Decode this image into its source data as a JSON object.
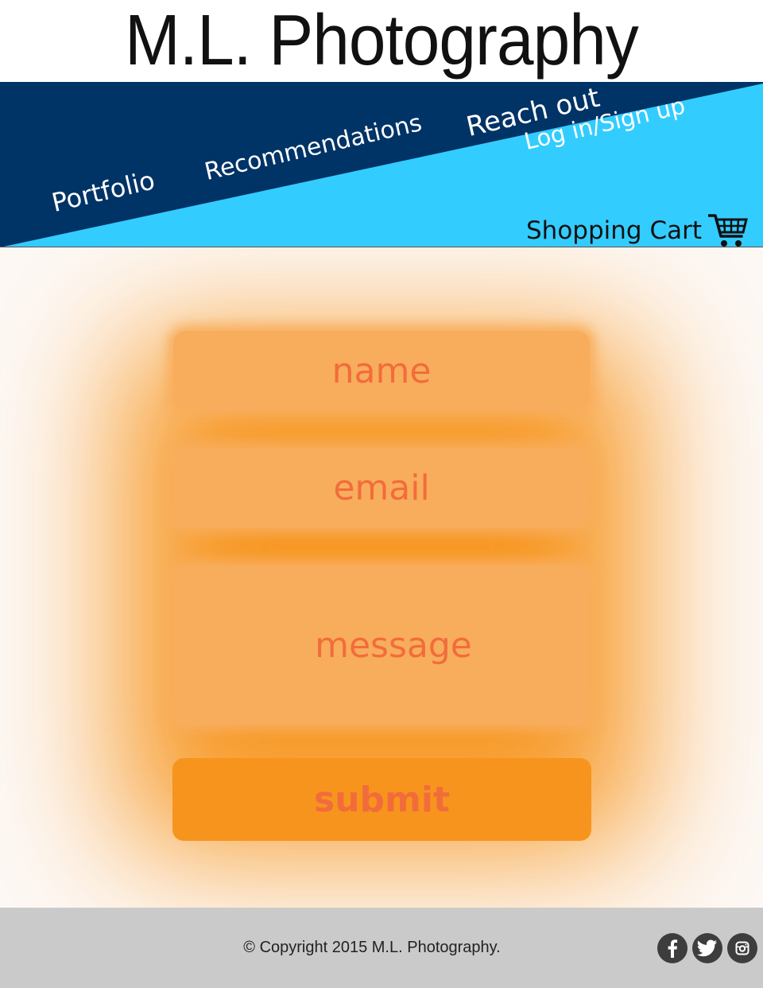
{
  "header": {
    "title": "M.L. Photography"
  },
  "nav": {
    "portfolio": "Portfolio",
    "recommendations": "Recommendations",
    "reach_out": "Reach out",
    "login": "Log in/Sign up",
    "cart": "Shopping Cart",
    "cart_icon": "shopping-cart-icon"
  },
  "form": {
    "name_placeholder": "name",
    "email_placeholder": "email",
    "message_placeholder": "message",
    "submit_label": "submit"
  },
  "footer": {
    "copyright": "© Copyright 2015 M.L. Photography.",
    "social": [
      "facebook-icon",
      "twitter-icon",
      "instagram-icon"
    ]
  },
  "colors": {
    "nav_dark": "#003366",
    "nav_light": "#33ccff",
    "accent_orange": "#f7941d",
    "field_fill": "#f8ad5c",
    "field_text": "#f26c3b",
    "footer_bg": "#cacaca"
  }
}
